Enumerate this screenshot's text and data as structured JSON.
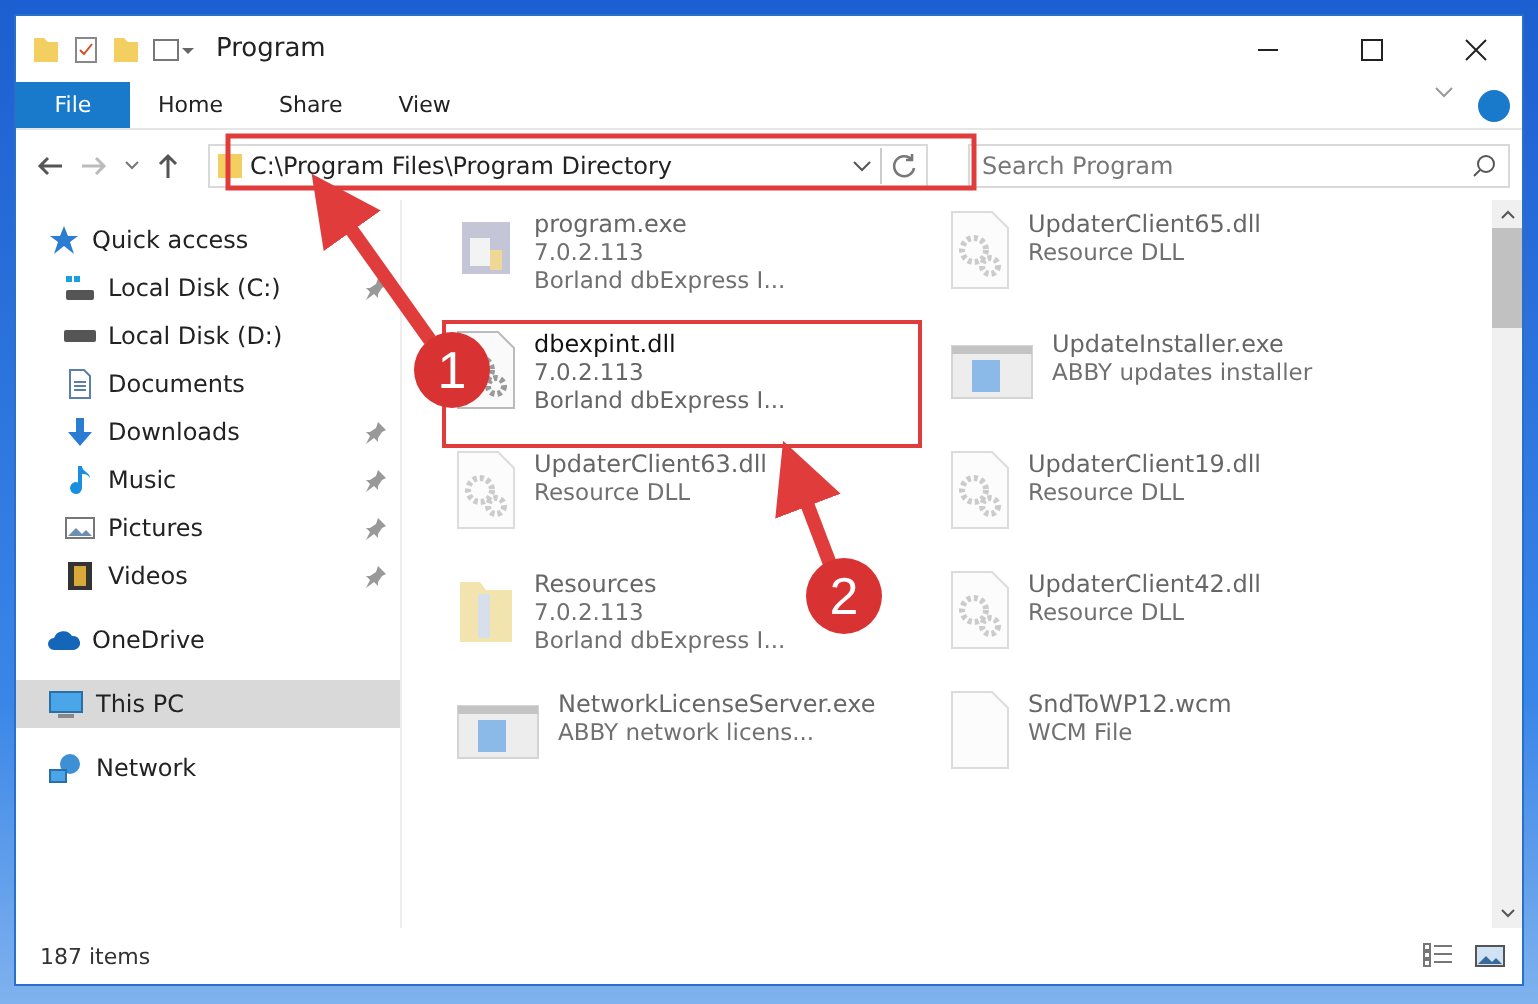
{
  "window": {
    "title": "Program"
  },
  "ribbon_tabs": [
    {
      "label": "File",
      "selected": true
    },
    {
      "label": "Home",
      "selected": false
    },
    {
      "label": "Share",
      "selected": false
    },
    {
      "label": "View",
      "selected": false
    }
  ],
  "address": {
    "path": "C:\\Program Files\\Program Directory"
  },
  "search": {
    "placeholder": "Search Program"
  },
  "sidebar": {
    "items": [
      {
        "label": "Quick access",
        "kind": "star",
        "pinned": false,
        "selected": false,
        "children": [
          {
            "label": "Local Disk (C:)",
            "kind": "disk-c",
            "pinned": true,
            "selected": false
          },
          {
            "label": "Local Disk (D:)",
            "kind": "disk",
            "pinned": false,
            "selected": false
          },
          {
            "label": "Documents",
            "kind": "doc",
            "pinned": false,
            "selected": false
          },
          {
            "label": "Downloads",
            "kind": "download",
            "pinned": true,
            "selected": false
          },
          {
            "label": "Music",
            "kind": "music",
            "pinned": true,
            "selected": false
          },
          {
            "label": "Pictures",
            "kind": "pictures",
            "pinned": true,
            "selected": false
          },
          {
            "label": "Videos",
            "kind": "videos",
            "pinned": true,
            "selected": false
          }
        ]
      },
      {
        "label": "OneDrive",
        "kind": "cloud",
        "pinned": false,
        "selected": false
      },
      {
        "label": "This PC",
        "kind": "pc",
        "pinned": false,
        "selected": true
      },
      {
        "label": "Network",
        "kind": "network",
        "pinned": false,
        "selected": false
      }
    ]
  },
  "files": [
    {
      "name": "program.exe",
      "details": [
        "7.0.2.113",
        "Borland dbExpress I..."
      ],
      "kind": "exe",
      "dimmed": true
    },
    {
      "name": "dbexpint.dll",
      "details": [
        "7.0.2.113",
        "Borland dbExpress I..."
      ],
      "kind": "dll",
      "dimmed": false,
      "framed": true
    },
    {
      "name": "UpdaterClient63.dll",
      "details": [
        "Resource DLL"
      ],
      "kind": "dll",
      "dimmed": true
    },
    {
      "name": "Resources",
      "details": [
        "7.0.2.113",
        "Borland dbExpress I..."
      ],
      "kind": "folder",
      "dimmed": true
    },
    {
      "name": "NetworkLicenseServer.exe",
      "details": [
        "ABBY network licens..."
      ],
      "kind": "app",
      "dimmed": true
    },
    {
      "name": "UpdaterClient65.dll",
      "details": [
        "Resource DLL"
      ],
      "kind": "dll",
      "dimmed": true
    },
    {
      "name": "UpdateInstaller.exe",
      "details": [
        "ABBY updates installer"
      ],
      "kind": "app",
      "dimmed": true
    },
    {
      "name": "UpdaterClient19.dll",
      "details": [
        "Resource DLL"
      ],
      "kind": "dll",
      "dimmed": true
    },
    {
      "name": "UpdaterClient42.dll",
      "details": [
        "Resource DLL"
      ],
      "kind": "dll",
      "dimmed": true
    },
    {
      "name": "SndToWP12.wcm",
      "details": [
        "WCM File"
      ],
      "kind": "file",
      "dimmed": true
    }
  ],
  "status_bar": {
    "count": "187 items"
  },
  "annotations": [
    {
      "label": "1"
    },
    {
      "label": "2"
    }
  ]
}
